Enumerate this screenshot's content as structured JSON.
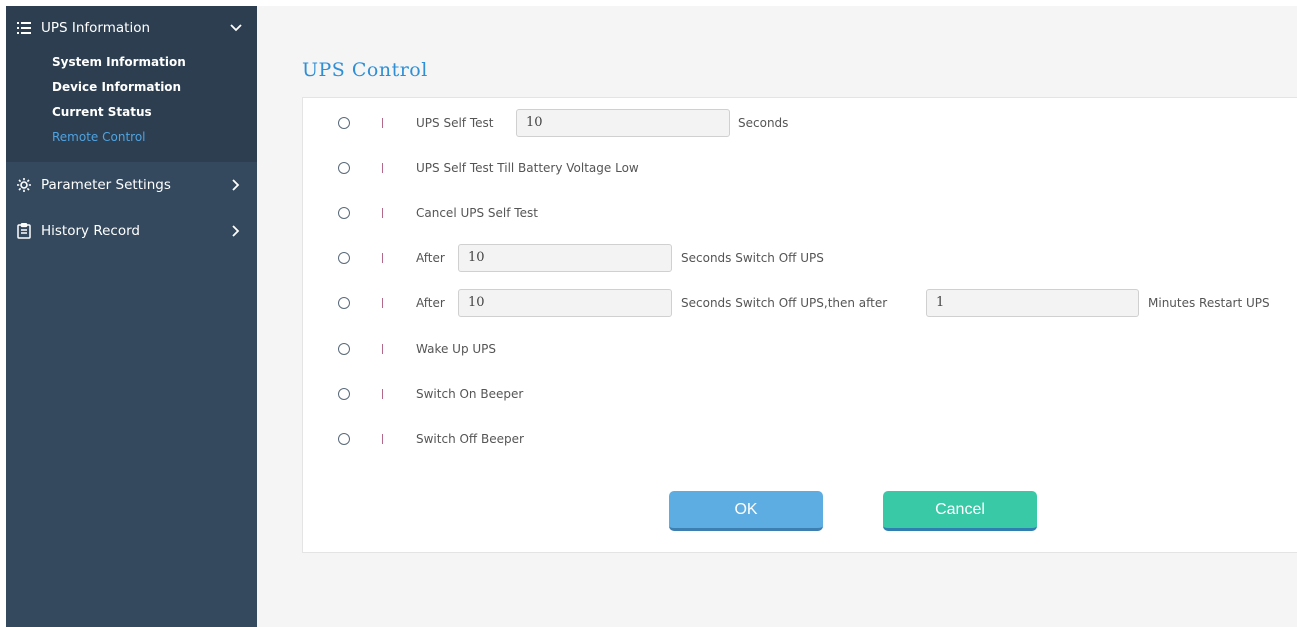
{
  "sidebar": {
    "groups": [
      {
        "label": "UPS Information",
        "icon": "list-icon",
        "expanded": true,
        "items": [
          {
            "label": "System Information",
            "active": false
          },
          {
            "label": "Device Information",
            "active": false
          },
          {
            "label": "Current Status",
            "active": false
          },
          {
            "label": "Remote Control",
            "active": true
          }
        ]
      },
      {
        "label": "Parameter Settings",
        "icon": "gear-icon",
        "expanded": false
      },
      {
        "label": "History Record",
        "icon": "clipboard-icon",
        "expanded": false
      }
    ]
  },
  "main": {
    "title": "UPS Control",
    "options": [
      {
        "prefix": "UPS Self Test",
        "value": "10",
        "suffix": "Seconds"
      },
      {
        "label": "UPS Self Test Till Battery Voltage Low"
      },
      {
        "label": "Cancel UPS Self Test"
      },
      {
        "prefix": "After",
        "value": "10",
        "suffix": "Seconds Switch Off UPS"
      },
      {
        "prefix": "After",
        "value": "10",
        "middle": "Seconds Switch Off UPS,then after",
        "value2": "1",
        "suffix": "Minutes Restart UPS"
      },
      {
        "label": "Wake Up UPS"
      },
      {
        "label": "Switch On Beeper"
      },
      {
        "label": "Switch Off Beeper"
      }
    ],
    "ok_label": "OK",
    "cancel_label": "Cancel"
  },
  "colors": {
    "sidebar_bg": "#34495e",
    "active_link": "#4fa3e0",
    "title": "#2e8fd6",
    "ok_button": "#5dade2",
    "cancel_button": "#3ac9a6"
  }
}
